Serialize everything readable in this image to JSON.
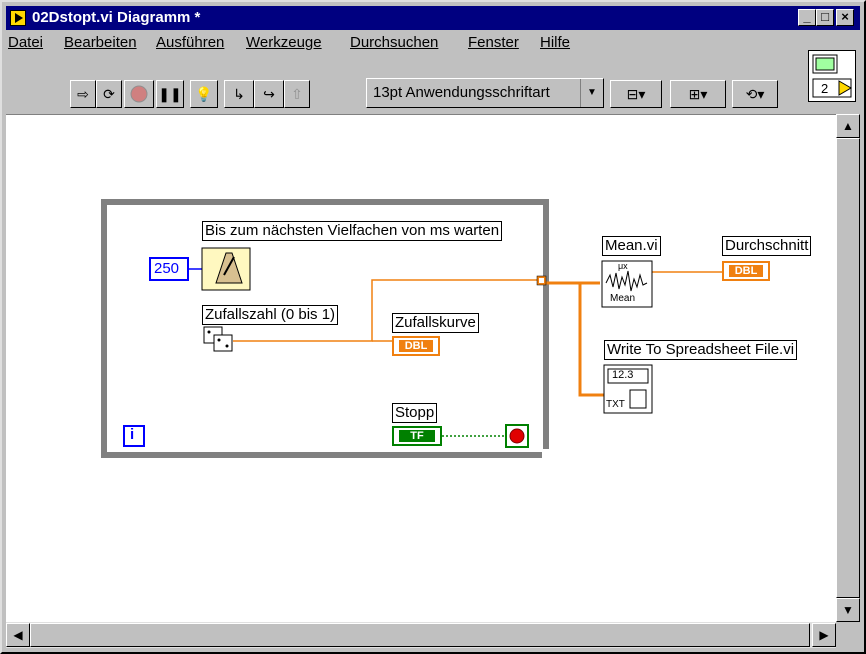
{
  "window": {
    "title": "02Dstopt.vi Diagramm *"
  },
  "menu": [
    "Datei",
    "Bearbeiten",
    "Ausführen",
    "Werkzeuge",
    "Durchsuchen",
    "Fenster",
    "Hilfe"
  ],
  "toolbar": {
    "font": "13pt Anwendungsschriftart"
  },
  "vi_icon": {
    "number": "2"
  },
  "diagram": {
    "wait_label": "Bis zum nächsten Vielfachen von ms warten",
    "constant": "250",
    "random_label": "Zufallszahl (0 bis 1)",
    "chart_label": "Zufallskurve",
    "dbl": "DBL",
    "stop_label": "Stopp",
    "tf": "TF",
    "iteration": "i",
    "mean_label": "Mean.vi",
    "mean_inner": "Mean",
    "mean_sym": "μx",
    "average_label": "Durchschnitt",
    "write_label": "Write To Spreadsheet File.vi",
    "write_num": "12.3",
    "write_txt": "TXT"
  },
  "colors": {
    "wire": "#f08010",
    "bool_wire": "#008000",
    "loop": "#808080",
    "title_bg": "#000080"
  }
}
